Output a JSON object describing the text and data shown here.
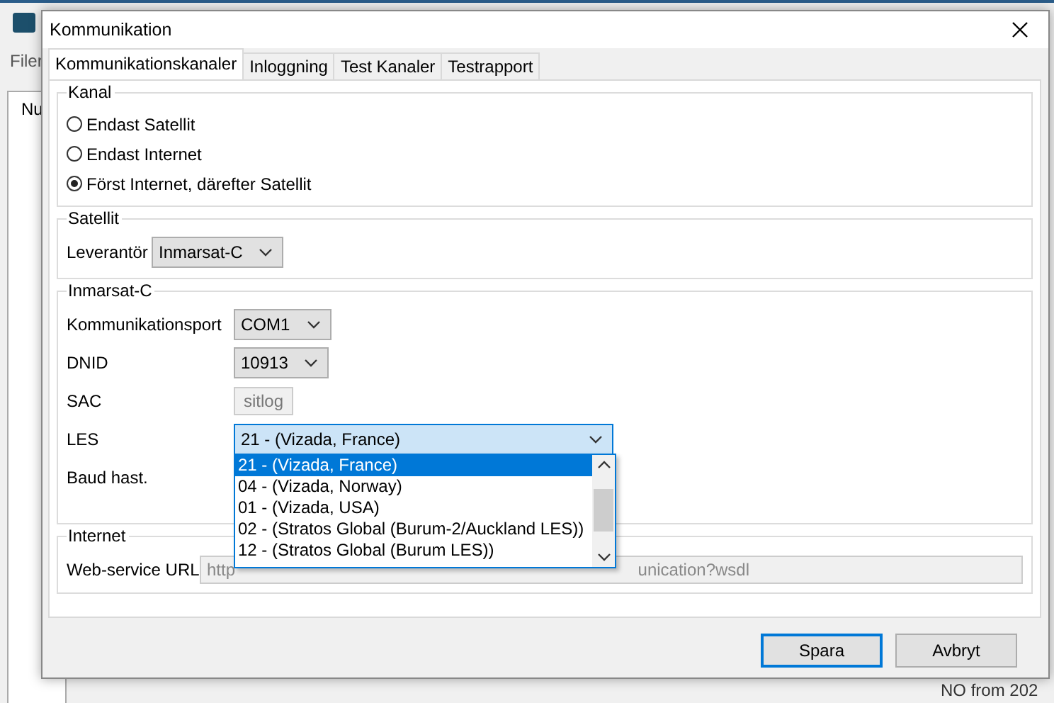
{
  "background_app": {
    "menu": [
      "Filer"
    ],
    "column_header": "Nu",
    "corner_text": "NO from 202"
  },
  "window": {
    "title": "Kommunikation"
  },
  "tabs": [
    {
      "label": "Kommunikationskanaler",
      "selected": true
    },
    {
      "label": "Inloggning",
      "selected": false
    },
    {
      "label": "Test Kanaler",
      "selected": false
    },
    {
      "label": "Testrapport",
      "selected": false
    }
  ],
  "kanal": {
    "title": "Kanal",
    "options": [
      {
        "label": "Endast Satellit",
        "selected": false
      },
      {
        "label": "Endast Internet",
        "selected": false
      },
      {
        "label": "Först Internet, därefter Satellit",
        "selected": true
      }
    ]
  },
  "satellit": {
    "title": "Satellit",
    "fields": [
      {
        "label": "Leverantör",
        "kind": "dropdown",
        "value": "Inmarsat-C"
      }
    ]
  },
  "inmarsat_c": {
    "title": "Inmarsat-C",
    "fields": [
      {
        "label": "Kommunikationsport",
        "kind": "dropdown",
        "value": "COM1"
      },
      {
        "label": "DNID",
        "kind": "dropdown",
        "value": "10913"
      },
      {
        "label": "SAC",
        "kind": "disabled_text",
        "value": "sitlog"
      },
      {
        "label": "LES",
        "kind": "open_dropdown",
        "value": "21 - (Vizada, France)",
        "options": [
          {
            "label": "21 - (Vizada, France)",
            "selected": true
          },
          {
            "label": "04 - (Vizada, Norway)",
            "selected": false
          },
          {
            "label": "01 - (Vizada, USA)",
            "selected": false
          },
          {
            "label": "02 - (Stratos Global (Burum-2/Auckland LES))",
            "selected": false
          },
          {
            "label": "12 - (Stratos Global (Burum LES))",
            "selected": false
          }
        ]
      },
      {
        "label": "Baud hast.",
        "kind": "hidden"
      }
    ]
  },
  "internet": {
    "title": "Internet",
    "fields": [
      {
        "label": "Web-service URL",
        "value_start": "http",
        "value_end": "unication?wsdl"
      }
    ]
  },
  "buttons": [
    {
      "label": "Spara",
      "default": true
    },
    {
      "label": "Avbryt",
      "default": false
    }
  ]
}
